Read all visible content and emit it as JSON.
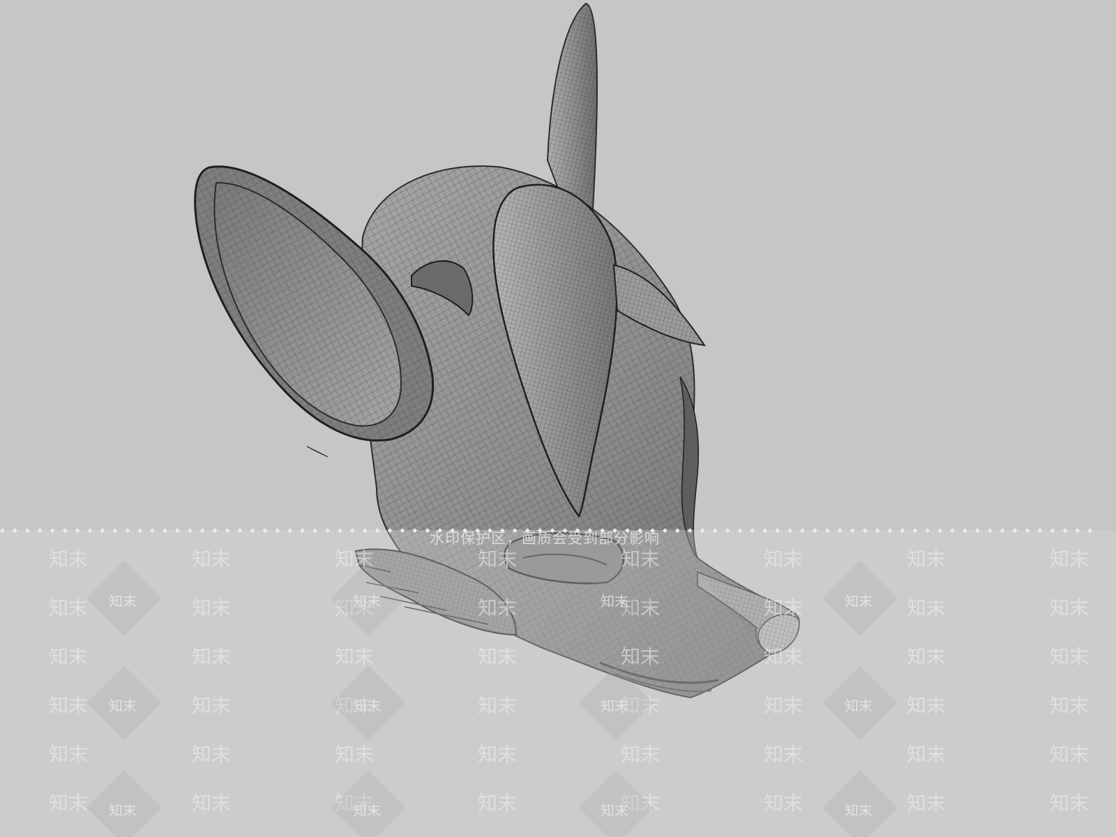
{
  "app": {
    "view": "3D wireframe-shaded viewport"
  },
  "colors": {
    "background": "#c6c6c6",
    "surface": "#8e8e8e",
    "surface_light": "#a9a9a9",
    "surface_dark": "#5a5a5a",
    "wire": "#3c3c3c"
  },
  "watermark": {
    "notice": "水印保护区，画质会受到部分影响",
    "brand": "知末"
  }
}
